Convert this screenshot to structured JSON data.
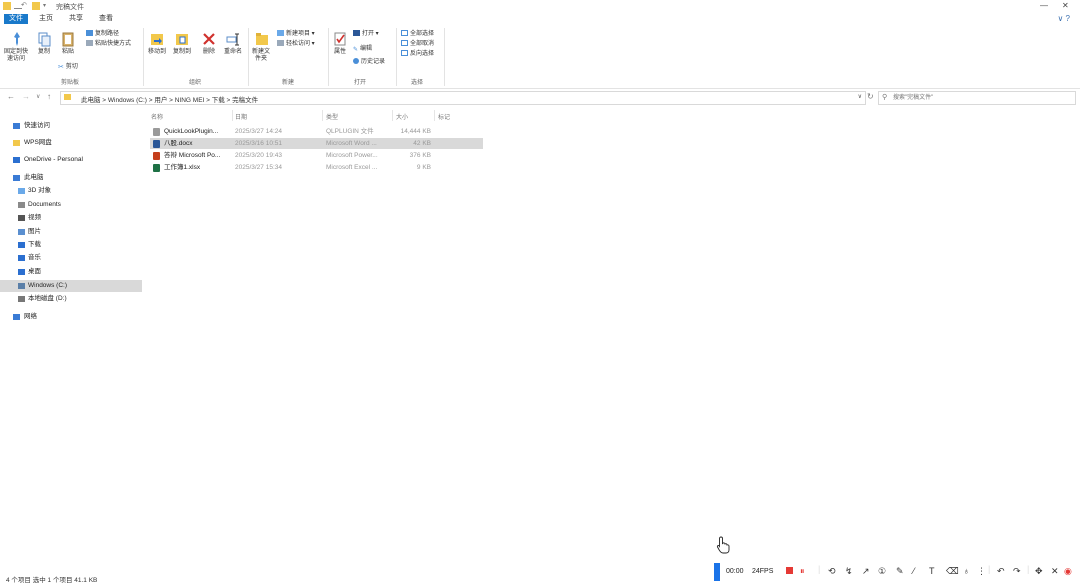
{
  "window": {
    "title": "完稿文件",
    "minimize": "—",
    "close": "✕"
  },
  "ribbon_tabs": [
    {
      "label": "文件",
      "active": true
    },
    {
      "label": "主页",
      "active": false
    },
    {
      "label": "共享",
      "active": false
    },
    {
      "label": "查看",
      "active": false
    }
  ],
  "ribbon_right": "∨ ?",
  "ribbon": {
    "clipboard": {
      "pin": "固定到快速访问",
      "copy": "复制",
      "paste": "粘贴",
      "cut_path": "复制路径",
      "paste_shortcut": "粘贴快捷方式",
      "cut": "剪切",
      "group": "剪贴板"
    },
    "organize": {
      "move_to": "移动到",
      "copy_to": "复制到",
      "delete": "删除",
      "rename": "重命名",
      "group": "组织"
    },
    "new": {
      "new_folder": "新建文件夹",
      "new_item": "新建项目 ▾",
      "easy_access": "轻松访问 ▾",
      "group": "新建"
    },
    "open": {
      "properties": "属性",
      "open": "打开 ▾",
      "edit": "编辑",
      "history": "历史记录",
      "group": "打开"
    },
    "select": {
      "select_all": "全部选择",
      "select_none": "全部取消",
      "invert": "反向选择",
      "group": "选择"
    }
  },
  "address": {
    "back": "←",
    "forward": "→",
    "recent": "∨",
    "up": "↑",
    "crumbs": "此电脑  >  Windows (C:)  >  用户  >  NING MEI  >  下载  >  完稿文件",
    "dropdown": "∨",
    "refresh": "↻",
    "search_placeholder": "搜索\"完稿文件\""
  },
  "nav": [
    {
      "label": "快速访问",
      "indent": 0,
      "color": "#3a7bd5",
      "selected": false
    },
    {
      "label": "WPS网盘",
      "indent": 0,
      "color": "#f2c84b",
      "selected": false
    },
    {
      "label": "OneDrive - Personal",
      "indent": 0,
      "color": "#2b6fd0",
      "selected": false
    },
    {
      "label": "此电脑",
      "indent": 0,
      "color": "#3a7bd5",
      "selected": false
    },
    {
      "label": "3D 对象",
      "indent": 1,
      "color": "#6aa9e9",
      "selected": false
    },
    {
      "label": "Documents",
      "indent": 1,
      "color": "#8a8a8a",
      "selected": false
    },
    {
      "label": "视频",
      "indent": 1,
      "color": "#555555",
      "selected": false
    },
    {
      "label": "图片",
      "indent": 1,
      "color": "#5a8fd0",
      "selected": false
    },
    {
      "label": "下载",
      "indent": 1,
      "color": "#2b6fd0",
      "selected": false
    },
    {
      "label": "音乐",
      "indent": 1,
      "color": "#2b6fd0",
      "selected": false
    },
    {
      "label": "桌面",
      "indent": 1,
      "color": "#2b6fd0",
      "selected": false
    },
    {
      "label": "Windows (C:)",
      "indent": 1,
      "color": "#5a7fa8",
      "selected": true
    },
    {
      "label": "本地磁盘 (D:)",
      "indent": 1,
      "color": "#777777",
      "selected": false
    },
    {
      "label": "网络",
      "indent": 0,
      "color": "#3a7bd5",
      "selected": false
    }
  ],
  "files": {
    "columns": [
      "名称",
      "日期",
      "类型",
      "大小",
      "标记"
    ],
    "rows": [
      {
        "name": "QuickLookPlugin...",
        "date": "2025/3/27 14:24",
        "type": "QLPLUGIN 文件",
        "size": "14,444 KB",
        "icon_color": "#9a9a9a",
        "selected": false
      },
      {
        "name": "八股.docx",
        "date": "2025/3/16 10:51",
        "type": "Microsoft Word ...",
        "size": "42 KB",
        "icon_color": "#2b5797",
        "selected": true
      },
      {
        "name": "答辩 Microsoft Po...",
        "date": "2025/3/20 19:43",
        "type": "Microsoft Power...",
        "size": "376 KB",
        "icon_color": "#c43e1c",
        "selected": false
      },
      {
        "name": "工作簿1.xlsx",
        "date": "2025/3/27 15:34",
        "type": "Microsoft Excel ...",
        "size": "9 KB",
        "icon_color": "#1e7145",
        "selected": false
      }
    ]
  },
  "status": "4 个项目    选中 1 个项目  41.1 KB",
  "recorder": {
    "time": "00:00",
    "fps": "24FPS",
    "accent": "#1a73e8",
    "record_color": "#e53935"
  }
}
